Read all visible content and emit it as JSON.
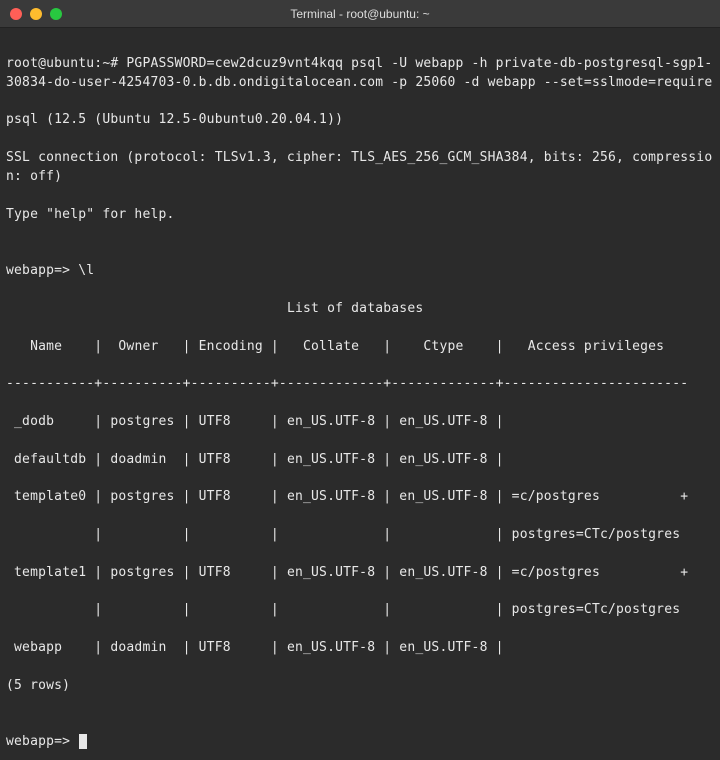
{
  "window": {
    "title": "Terminal - root@ubuntu: ~"
  },
  "lines": {
    "l1": "root@ubuntu:~# PGPASSWORD=cew2dcuz9vnt4kqq psql -U webapp -h private-db-postgresql-sgp1-30834-do-user-4254703-0.b.db.ondigitalocean.com -p 25060 -d webapp --set=sslmode=require",
    "l2": "psql (12.5 (Ubuntu 12.5-0ubuntu0.20.04.1))",
    "l3": "SSL connection (protocol: TLSv1.3, cipher: TLS_AES_256_GCM_SHA384, bits: 256, compression: off)",
    "l4": "Type \"help\" for help.",
    "l5": "",
    "l6": "webapp=> \\l",
    "l7": "                                   List of databases",
    "l8": "   Name    |  Owner   | Encoding |   Collate   |    Ctype    |   Access privileges   ",
    "l9": "-----------+----------+----------+-------------+-------------+-----------------------",
    "l10": " _dodb     | postgres | UTF8     | en_US.UTF-8 | en_US.UTF-8 | ",
    "l11": " defaultdb | doadmin  | UTF8     | en_US.UTF-8 | en_US.UTF-8 | ",
    "l12": " template0 | postgres | UTF8     | en_US.UTF-8 | en_US.UTF-8 | =c/postgres          +",
    "l13": "           |          |          |             |             | postgres=CTc/postgres",
    "l14": " template1 | postgres | UTF8     | en_US.UTF-8 | en_US.UTF-8 | =c/postgres          +",
    "l15": "           |          |          |             |             | postgres=CTc/postgres",
    "l16": " webapp    | doadmin  | UTF8     | en_US.UTF-8 | en_US.UTF-8 | ",
    "l17": "(5 rows)",
    "l18": "",
    "l19": "webapp=> "
  }
}
